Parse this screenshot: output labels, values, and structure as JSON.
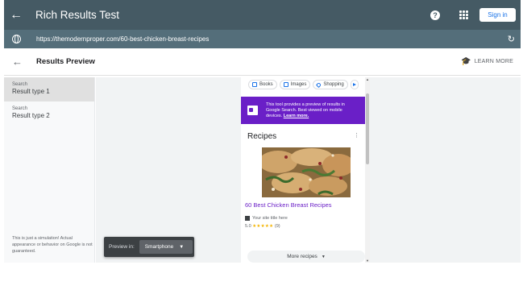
{
  "app": {
    "title": "Rich Results Test",
    "signin_label": "Sign in",
    "help_label": "?"
  },
  "urlbar": {
    "url": "https://themodernproper.com/60-best-chicken-breast-recipes"
  },
  "results_header": {
    "title": "Results Preview",
    "learn_more": "LEARN MORE"
  },
  "sidebar": {
    "items": [
      {
        "category": "Search",
        "label": "Result type 1",
        "active": true
      },
      {
        "category": "Search",
        "label": "Result type 2",
        "active": false
      }
    ],
    "disclaimer": "This is just a simulation! Actual appearance or behavior on Google is not guaranteed."
  },
  "preview_in": {
    "label": "Preview in:",
    "selected": "Smartphone"
  },
  "phone": {
    "chips": [
      "Books",
      "Images",
      "Shopping"
    ],
    "banner": {
      "text": "This tool provides a preview of results in Google Search. Best viewed on mobile devices.",
      "link": "Learn more."
    },
    "card": {
      "title": "Recipes",
      "recipe_title": "60 Best Chicken Breast Recipes",
      "site": "Your site title here",
      "rating_value": "5.0",
      "rating_stars": "★★★★★",
      "rating_count": "(9)",
      "more_label": "More recipes"
    }
  },
  "colors": {
    "topbar": "#455a64",
    "urlbar": "#546e7a",
    "banner": "#6a1fc7",
    "signin_text": "#1a73e8"
  }
}
